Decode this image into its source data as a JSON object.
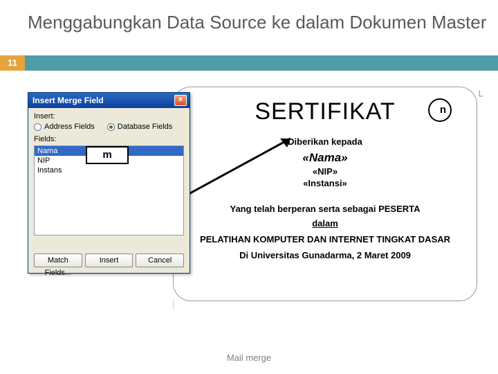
{
  "slide": {
    "number": "11",
    "title": "Menggabungkan Data Source ke dalam Dokumen Master",
    "footer": "Mail merge"
  },
  "dialog": {
    "title": "Insert Merge Field",
    "insert_label": "Insert:",
    "radio_address": "Address Fields",
    "radio_database": "Database Fields",
    "fields_label": "Fields:",
    "fields": [
      "Nama",
      "NIP",
      "Instans"
    ],
    "btn_match": "Match Fields...",
    "btn_insert": "Insert",
    "btn_cancel": "Cancel"
  },
  "callouts": {
    "m": "m",
    "n": "n"
  },
  "doc": {
    "title": "SERTIFIKAT",
    "given_to": "Diberikan kepada",
    "merge_nama": "«Nama»",
    "merge_nip": "«NIP»",
    "merge_instansi": "«Instansi»",
    "line_role": "Yang telah berperan serta sebagai PESERTA",
    "line_dalam": "dalam",
    "line_event": "PELATIHAN KOMPUTER DAN INTERNET TINGKAT DASAR",
    "line_place": "Di Universitas Gunadarma, 2 Maret 2009"
  }
}
